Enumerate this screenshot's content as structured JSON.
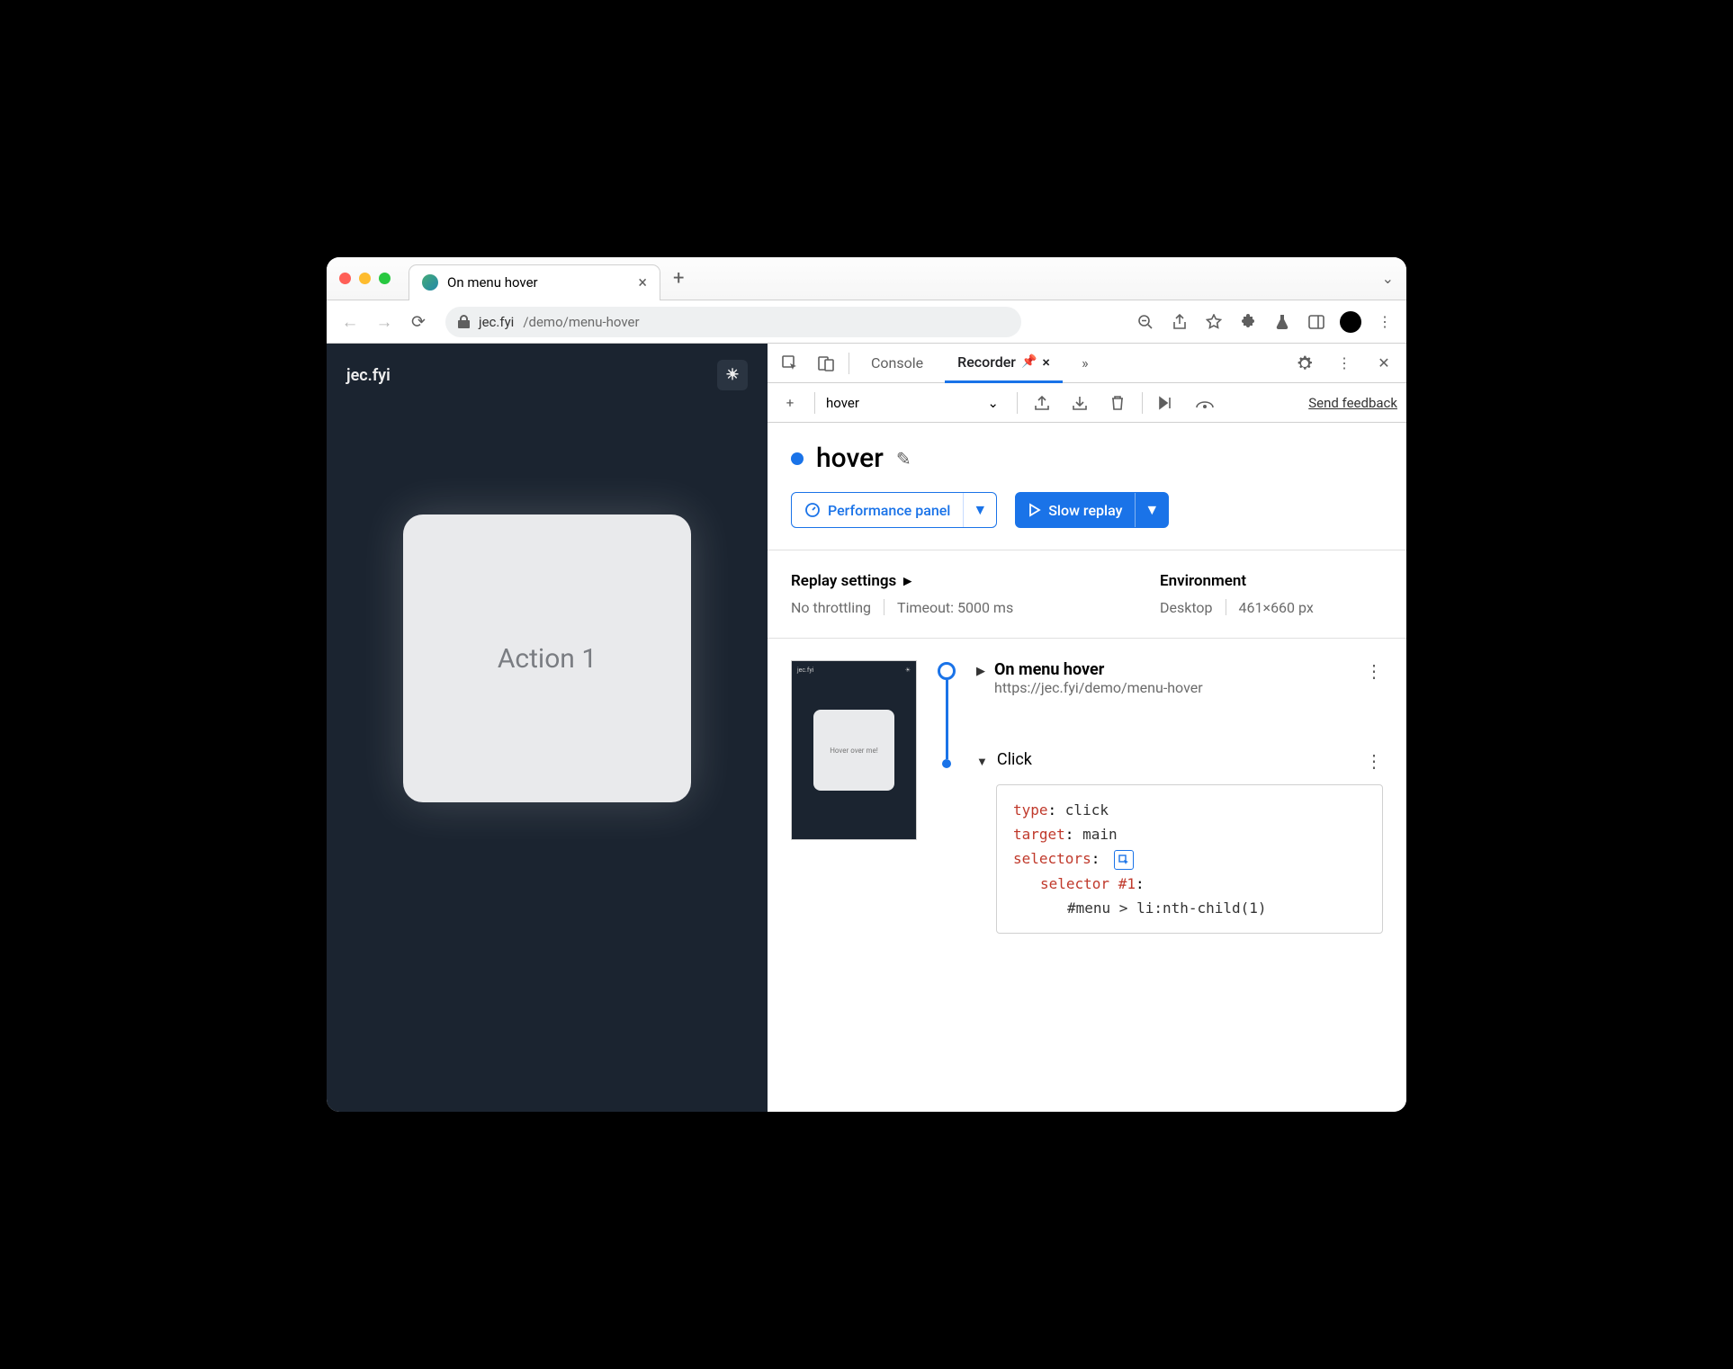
{
  "browser": {
    "tab_title": "On menu hover",
    "url_host": "jec.fyi",
    "url_path": "/demo/menu-hover"
  },
  "page": {
    "site_name": "jec.fyi",
    "card_text": "Action 1"
  },
  "devtools": {
    "tabs": {
      "console": "Console",
      "recorder": "Recorder"
    },
    "subbar": {
      "recording_select": "hover",
      "feedback": "Send feedback"
    },
    "title": "hover",
    "buttons": {
      "perf": "Performance panel",
      "replay": "Slow replay"
    },
    "settings": {
      "heading": "Replay settings",
      "throttling": "No throttling",
      "timeout": "Timeout: 5000 ms",
      "env_heading": "Environment",
      "env_device": "Desktop",
      "env_size": "461×660 px"
    },
    "steps": {
      "thumb_card": "Hover over me!",
      "initial": {
        "title": "On menu hover",
        "url": "https://jec.fyi/demo/menu-hover"
      },
      "click": {
        "label": "Click",
        "type_k": "type",
        "type_v": "click",
        "target_k": "target",
        "target_v": "main",
        "selectors_k": "selectors",
        "sel_label": "selector #1",
        "sel_value": "#menu > li:nth-child(1)"
      }
    }
  }
}
